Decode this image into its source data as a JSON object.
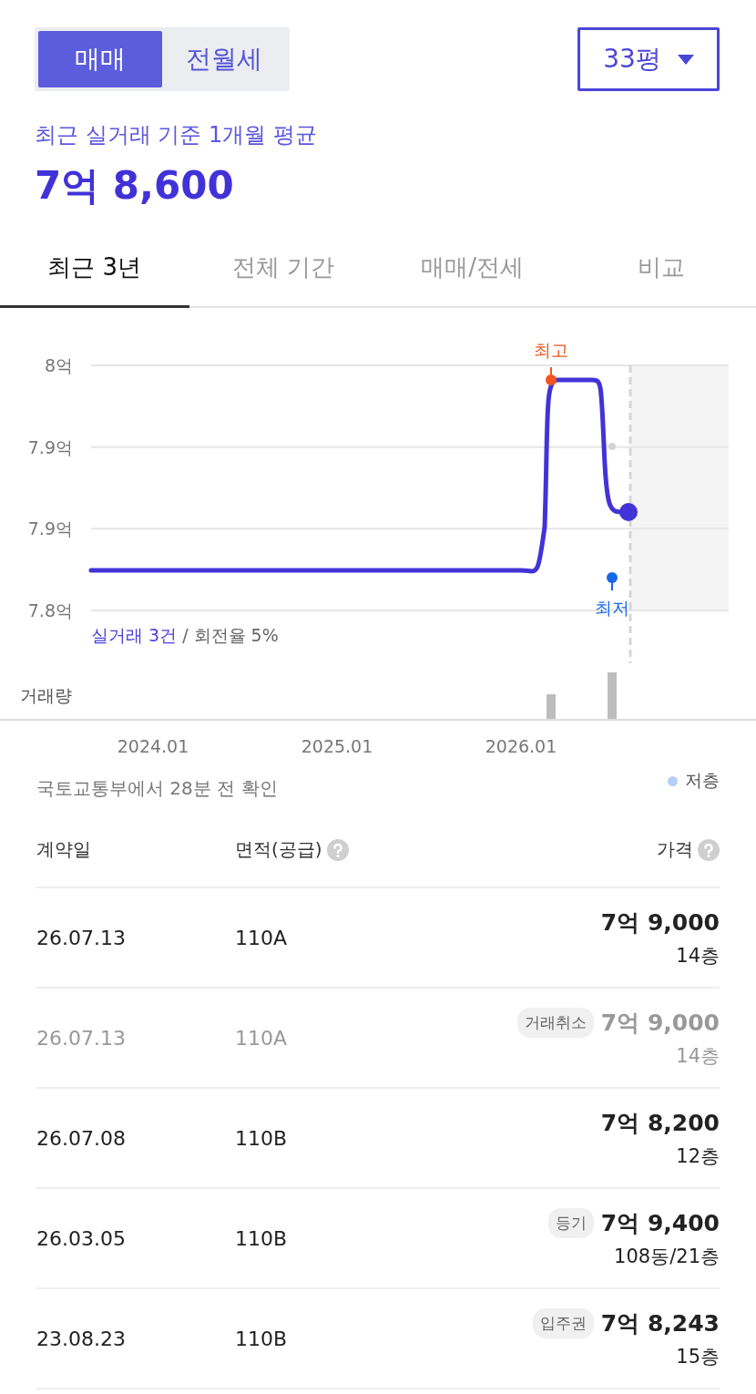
{
  "trade_toggle": [
    {
      "label": "매매",
      "selected": true
    },
    {
      "label": "전월세",
      "selected": false
    }
  ],
  "size_dropdown": {
    "value": "33평"
  },
  "average": {
    "caption": "최근 실거래 기준 1개월 평균",
    "price": "7억 8,600"
  },
  "tabs": [
    {
      "label": "최근 3년",
      "selected": true
    },
    {
      "label": "전체 기간",
      "selected": false
    },
    {
      "label": "매매/전세",
      "selected": false
    },
    {
      "label": "비교",
      "selected": false
    }
  ],
  "price_chart": {
    "y_axis_labels": [
      "8억",
      "7.9억",
      "7.9억",
      "7.8억"
    ],
    "x_axis_labels": [
      "2024.01",
      "2025.01",
      "2026.01"
    ],
    "markers": [
      {
        "kind": "high",
        "text": "최고"
      },
      {
        "kind": "low",
        "text": "최저"
      }
    ],
    "deals": "실거래 3건",
    "turnover": "/ 회전율 5%",
    "volume_label": "거래량"
  },
  "source_note": "국토교통부에서 28분 전 확인",
  "legend": [
    {
      "label": "저층",
      "color": "#b5d1f5"
    }
  ],
  "table": {
    "columns": [
      "계약일",
      "면적(공급)",
      "가격"
    ],
    "rows": [
      {
        "date": "26.07.13",
        "area": "110A",
        "price": "7억 9,000",
        "floor": "14층",
        "cancelled": false
      },
      {
        "date": "26.07.13",
        "area": "110A",
        "price": "7억 9,000",
        "floor": "14층",
        "tag": "거래취소",
        "cancelled": true
      },
      {
        "date": "26.07.08",
        "area": "110B",
        "price": "7억 8,200",
        "floor": "12층",
        "cancelled": false
      },
      {
        "date": "26.03.05",
        "area": "110B",
        "price": "7억 9,400",
        "floor": "108동/21층",
        "tag": "등기",
        "cancelled": false
      },
      {
        "date": "23.08.23",
        "area": "110B",
        "price": "7억 8,243",
        "floor": "15층",
        "tag": "입주권",
        "cancelled": false
      }
    ]
  }
}
